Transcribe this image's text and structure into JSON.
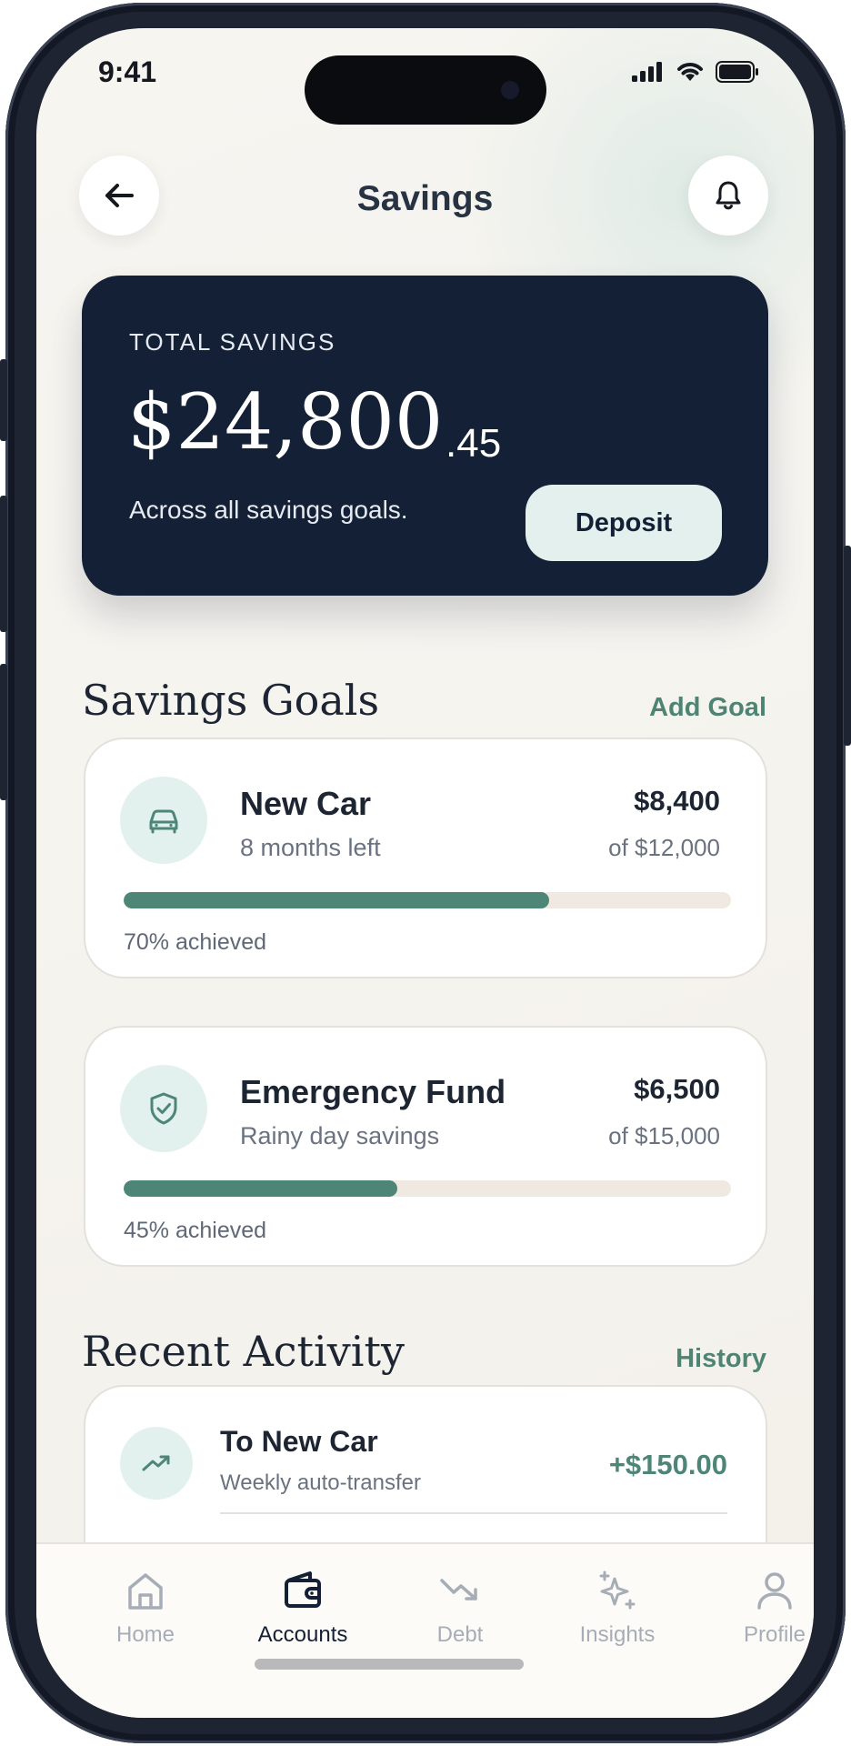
{
  "status_bar": {
    "time": "9:41"
  },
  "header": {
    "title": "Savings",
    "back_icon": "arrow-left-icon",
    "notify_icon": "bell-icon"
  },
  "total": {
    "label": "TOTAL SAVINGS",
    "amount": "$24,800",
    "cents": ".45",
    "subtitle": "Across all savings goals.",
    "deposit_label": "Deposit"
  },
  "goals_section": {
    "title": "Savings Goals",
    "action": "Add Goal"
  },
  "goals": [
    {
      "name": "New Car",
      "subtitle": "8 months left",
      "amount": "$8,400",
      "target": "of $12,000",
      "progress": 0.7,
      "progress_label": "70% achieved",
      "icon": "car-icon"
    },
    {
      "name": "Emergency Fund",
      "subtitle": "Rainy day savings",
      "amount": "$6,500",
      "target": "of $15,000",
      "progress": 0.45,
      "progress_label": "45% achieved",
      "icon": "shield-check-icon"
    }
  ],
  "activity_section": {
    "title": "Recent Activity",
    "action": "History"
  },
  "activity": [
    {
      "title": "To New Car",
      "subtitle": "Weekly auto-transfer",
      "amount": "+$150.00",
      "icon": "trending-up-icon"
    }
  ],
  "tabs": [
    {
      "label": "Home",
      "icon": "home-icon",
      "active": false
    },
    {
      "label": "Accounts",
      "icon": "wallet-icon",
      "active": true
    },
    {
      "label": "Debt",
      "icon": "trending-down-icon",
      "active": false
    },
    {
      "label": "Insights",
      "icon": "sparkles-icon",
      "active": false
    },
    {
      "label": "Profile",
      "icon": "user-icon",
      "active": false
    }
  ],
  "colors": {
    "accent": "#4d8677",
    "card_dark": "#142035",
    "background": "#f5f3ee"
  }
}
